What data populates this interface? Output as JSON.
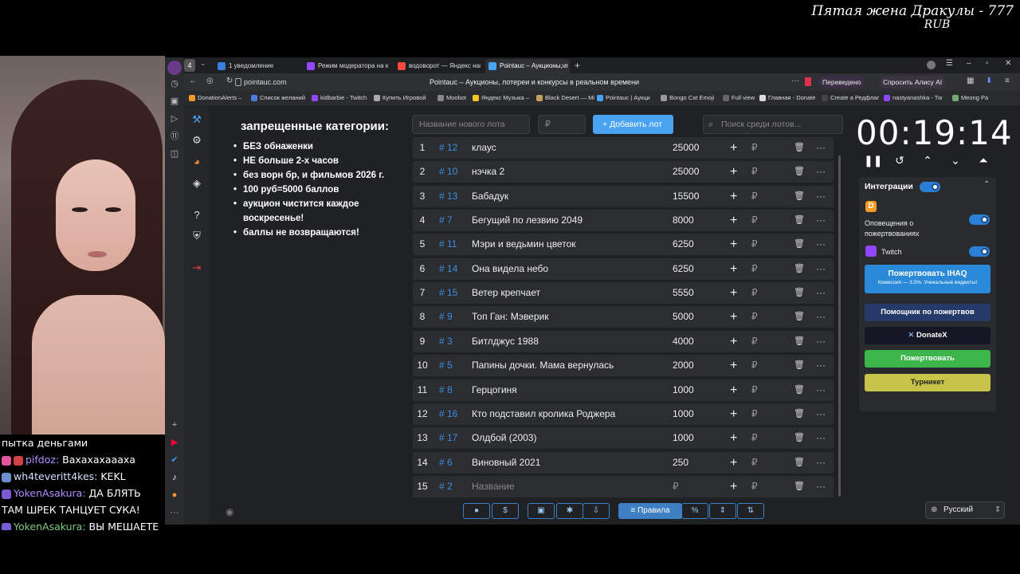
{
  "overlay": {
    "title_line1": "Пятая жена Дракулы - 777",
    "title_line2": "RUB"
  },
  "chat": [
    {
      "user": "",
      "text": "пытка деньгами"
    },
    {
      "user": "pifdoz:",
      "text": "Ваxахахаааха"
    },
    {
      "user": "wh4teveritt4kes:",
      "text": "KEKL"
    },
    {
      "user": "YokenAsakura:",
      "text": "ДА БЛЯТЬ"
    },
    {
      "user": "",
      "text": "ТАМ ШРЕК ТАНЦУЕТ СУКА!"
    },
    {
      "user": "YokenAsakura:",
      "text": "ВЫ МЕШАЕТЕ"
    }
  ],
  "browser": {
    "tabs": [
      {
        "label": "1 уведомление",
        "color": "#3b7ddd"
      },
      {
        "label": "Режим модератора на к",
        "color": "#9146ff"
      },
      {
        "label": "водоворот — Яндекс нап",
        "color": "#f04c3c"
      },
      {
        "label": "Pointauc – Аукционы, л",
        "color": "#47a3f3"
      }
    ],
    "url": "pointauc.com",
    "page_title": "Pointauc – Аукционы, лотереи и конкурсы в реальном времени",
    "translated": "Переведено",
    "ask_alice": "Спросить Алису AI",
    "bookmarks": [
      "DonationAlerts –",
      "Список желаний",
      "kidbarbie - Twitch",
      "Купить Игровой",
      "Moobot",
      "Яндекс Музыка –",
      "Black Desert — Mi",
      "Pointauc | Аукци",
      "Bongo Cat Emoji",
      "Full view",
      "Главная - Donate",
      "Create a Редфлаг",
      "nastyanashka - Tw",
      "Meong Pa"
    ]
  },
  "rules": {
    "title": "запрещенные категории:",
    "items": [
      "БЕЗ обнаженки",
      "НЕ больше 2-х часов",
      "без ворн бр, и фильмов 2026 г.",
      "100 руб=5000 баллов",
      "аукцион чистится каждое воскресенье!",
      "баллы не возвращаются!"
    ]
  },
  "toolbar": {
    "new_lot_placeholder": "Название нового лота",
    "amount_placeholder": "₽",
    "add_label": "Добавить лот",
    "search_placeholder": "Поиск среди лотов..."
  },
  "lots": [
    {
      "n": "1",
      "id": "# 12",
      "name": "клаус",
      "amount": "25000"
    },
    {
      "n": "2",
      "id": "# 10",
      "name": "нэчка 2",
      "amount": "25000"
    },
    {
      "n": "3",
      "id": "# 13",
      "name": "Бабадук",
      "amount": "15500"
    },
    {
      "n": "4",
      "id": "# 7",
      "name": "Бегущий по лезвию 2049",
      "amount": "8000"
    },
    {
      "n": "5",
      "id": "# 11",
      "name": "Мэри и ведьмин цветок",
      "amount": "6250"
    },
    {
      "n": "6",
      "id": "# 14",
      "name": "Она видела небо",
      "amount": "6250"
    },
    {
      "n": "7",
      "id": "# 15",
      "name": "Ветер крепчает",
      "amount": "5550"
    },
    {
      "n": "8",
      "id": "# 9",
      "name": "Топ Ган: Мэверик",
      "amount": "5000"
    },
    {
      "n": "9",
      "id": "# 3",
      "name": "Битлджус 1988",
      "amount": "4000"
    },
    {
      "n": "10",
      "id": "# 5",
      "name": "Папины дочки. Мама вернулась",
      "amount": "2000"
    },
    {
      "n": "11",
      "id": "# 8",
      "name": "Герцогиня",
      "amount": "1000"
    },
    {
      "n": "12",
      "id": "# 16",
      "name": "Кто подставил кролика Роджера",
      "amount": "1000"
    },
    {
      "n": "13",
      "id": "# 17",
      "name": "Олдбой (2003)",
      "amount": "1000"
    },
    {
      "n": "14",
      "id": "# 6",
      "name": "Виновный 2021",
      "amount": "250"
    },
    {
      "n": "15",
      "id": "# 2",
      "name": "Название",
      "amount": "₽",
      "placeholder": true
    }
  ],
  "lot_row_symbols": {
    "plus": "+",
    "rub": "₽",
    "delete": "🗑",
    "more": "···"
  },
  "timer": {
    "value": "00:19:14"
  },
  "integrations": {
    "title": "Интеграции",
    "donationalerts_label": "Оповещения о пожертвованиях",
    "twitch_label": "Twitch",
    "donate_ihaq": "Пожертвовать IHAQ",
    "donate_ihaq_sub": "Комиссия — 3,5%. Уникальные виджеты!",
    "helper": "Помощник по пожертвов",
    "donatex": "DonateX",
    "donate": "Пожертвовать",
    "turniket": "Турникет"
  },
  "bottom": {
    "rules": "Правила",
    "language": "Русский"
  }
}
